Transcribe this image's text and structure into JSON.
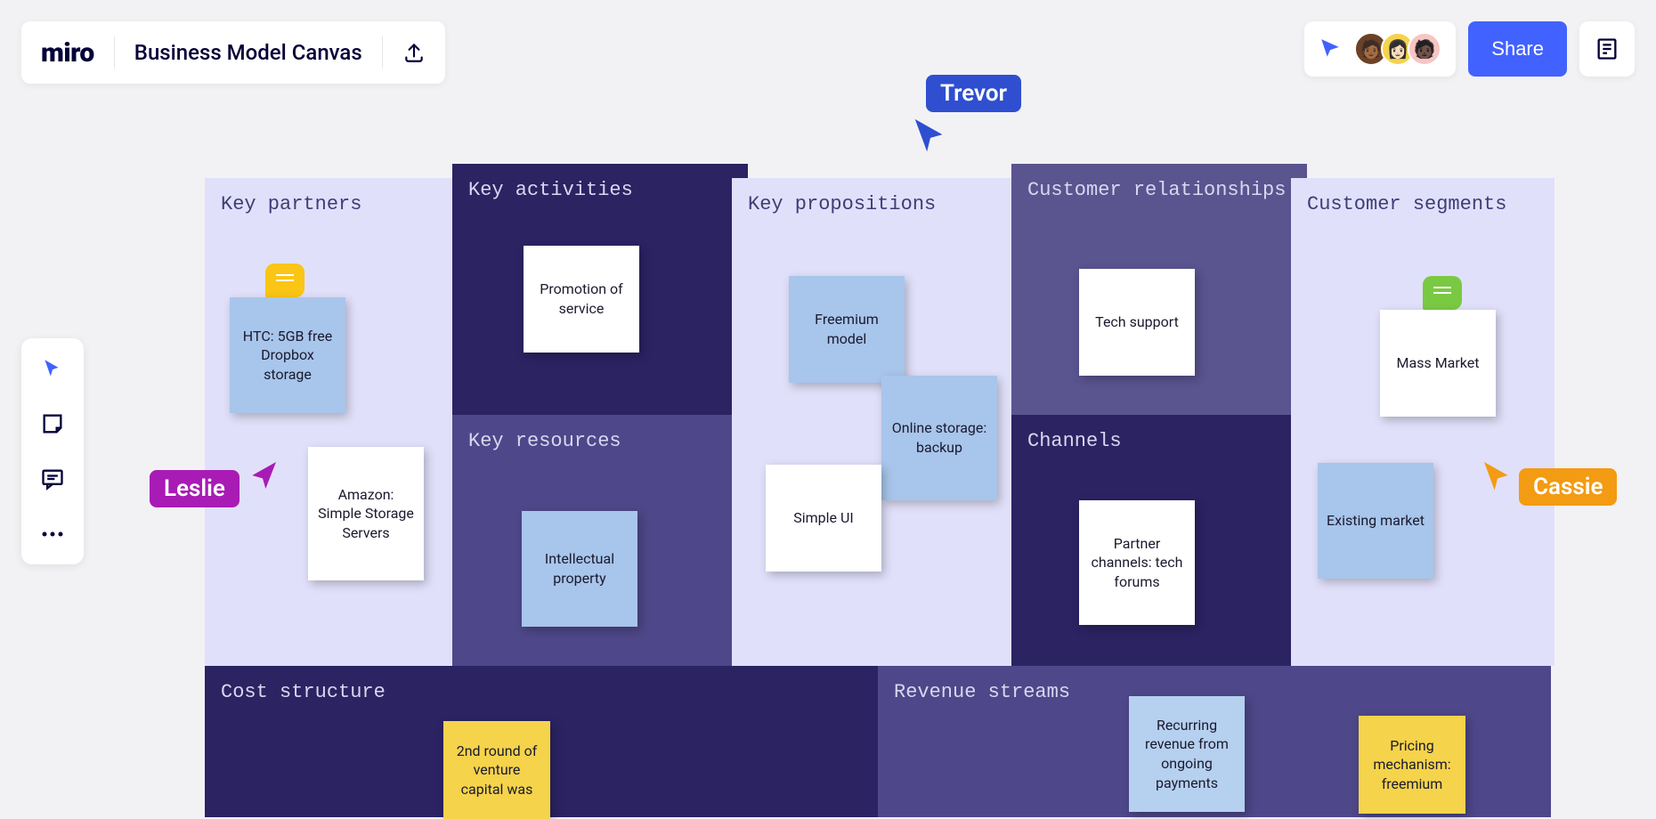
{
  "app": {
    "logo": "miro",
    "board_title": "Business Model Canvas",
    "share_label": "Share"
  },
  "cursors": {
    "trevor": {
      "name": "Trevor",
      "color": "#2f4fd0"
    },
    "leslie": {
      "name": "Leslie",
      "color": "#a81bb5"
    },
    "cassie": {
      "name": "Cassie",
      "color": "#f39b12"
    }
  },
  "sections": {
    "key_partners": {
      "title": "Key partners",
      "stickies": [
        {
          "text": "HTC: 5GB free Dropbox storage",
          "color": "blue"
        },
        {
          "text": "Amazon: Simple Storage Servers",
          "color": "white"
        }
      ]
    },
    "key_activities": {
      "title": "Key activities",
      "stickies": [
        {
          "text": "Promotion of service",
          "color": "white"
        }
      ]
    },
    "key_resources": {
      "title": "Key resources",
      "stickies": [
        {
          "text": "Intellectual property",
          "color": "blue"
        }
      ]
    },
    "key_propositions": {
      "title": "Key propositions",
      "stickies": [
        {
          "text": "Freemium model",
          "color": "blue"
        },
        {
          "text": "Online storage: backup",
          "color": "blue"
        },
        {
          "text": "Simple UI",
          "color": "white"
        }
      ]
    },
    "customer_relationships": {
      "title": "Customer relationships",
      "stickies": [
        {
          "text": "Tech support",
          "color": "white"
        }
      ]
    },
    "channels": {
      "title": "Channels",
      "stickies": [
        {
          "text": "Partner channels: tech forums",
          "color": "white"
        }
      ]
    },
    "customer_segments": {
      "title": "Customer segments",
      "stickies": [
        {
          "text": "Mass Market",
          "color": "white"
        },
        {
          "text": "Existing market",
          "color": "blue"
        }
      ]
    },
    "cost_structure": {
      "title": "Cost structure",
      "stickies": [
        {
          "text": "2nd round of venture capital was",
          "color": "yellow"
        }
      ]
    },
    "revenue_streams": {
      "title": "Revenue streams",
      "stickies": [
        {
          "text": "Recurring revenue from ongoing payments",
          "color": "lblue"
        },
        {
          "text": "Pricing mechanism: freemium",
          "color": "yellow"
        }
      ]
    }
  }
}
